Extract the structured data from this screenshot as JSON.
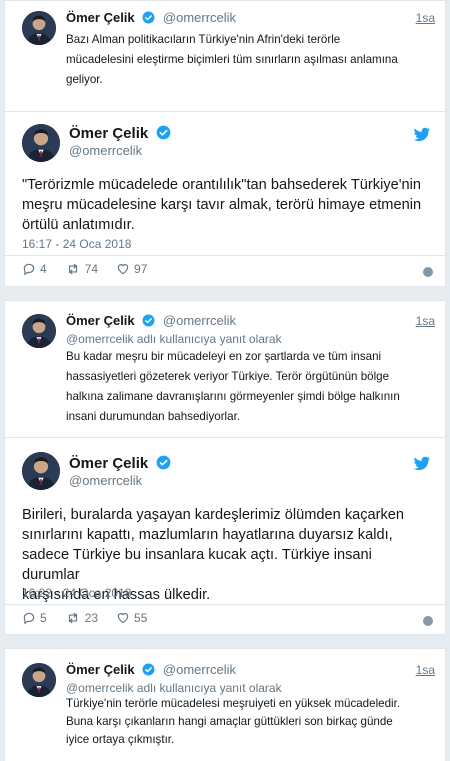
{
  "author": {
    "name": "Ömer Çelik",
    "handle": "@omerrcelik",
    "verified_color": "#1da1f2"
  },
  "tweet1": {
    "time": "1sa",
    "text_lines": [
      "Bazı Alman politikacıların Türkiye'nin Afrin'deki terörle",
      "mücadelesini eleştirme biçimleri tüm sınırların aşılması anlamına",
      "geliyor."
    ]
  },
  "tweet2": {
    "text_lines": [
      "\"Terörizmle mücadelede orantılılık\"tan bahsederek Türkiye'nin",
      "meşru mücadelesine karşı tavır almak, terörü himaye etmenin",
      "örtülü anlatımıdır."
    ],
    "timestamp": "16:17 - 24 Oca 2018",
    "replies": "4",
    "retweets": "74",
    "likes": "97"
  },
  "tweet3": {
    "time": "1sa",
    "reply_context": "@omerrcelik adlı kullanıcıya yanıt olarak",
    "text_lines": [
      "Bu kadar meşru bir mücadeleyi en zor şartlarda ve tüm insani",
      "hassasiyetleri gözeterek veriyor Türkiye. Terör örgütünün bölge",
      "halkına zalimane davranışlarını görmeyenler şimdi bölge halkının",
      "insani durumundan bahsediyorlar."
    ]
  },
  "tweet4": {
    "text_lines": [
      "Birileri, buralarda yaşayan kardeşlerimiz ölümden kaçarken",
      "sınırlarını kapattı, mazlumların hayatlarına duyarsız kaldı,",
      "sadece Türkiye bu insanlara kucak açtı. Türkiye insani durumlar",
      "karşısında en hassas ülkedir."
    ],
    "timestamp": "16:22 - 24 Oca 2018",
    "replies": "5",
    "retweets": "23",
    "likes": "55"
  },
  "tweet5": {
    "time": "1sa",
    "reply_context": "@omerrcelik adlı kullanıcıya yanıt olarak",
    "text_lines": [
      "Türkiye'nin terörle mücadelesi meşruiyeti en yüksek mücadeledir.",
      "Buna karşı çıkanların hangi amaçlar güttükleri son birkaç günde",
      "iyice  ortaya çıkmıştır."
    ]
  },
  "icons": {
    "verified": "verified-badge-icon",
    "bird": "twitter-bird-icon",
    "reply": "reply-icon",
    "retweet": "retweet-icon",
    "like": "heart-icon",
    "info": "info-icon"
  },
  "colors": {
    "twitter_blue": "#1da1f2",
    "muted": "#657786",
    "background": "#e6ecf0"
  }
}
